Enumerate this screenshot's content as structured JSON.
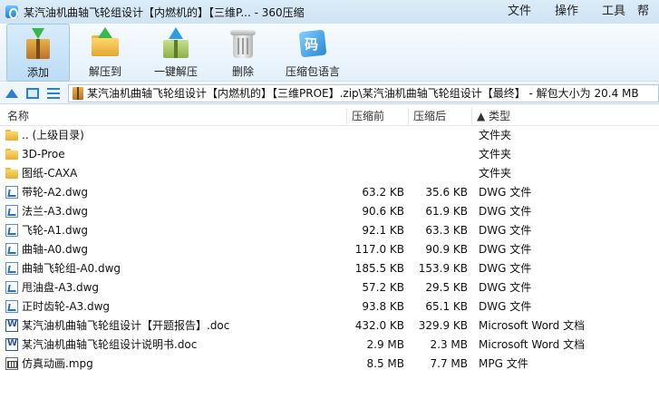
{
  "window": {
    "title": "某汽油机曲轴飞轮组设计【内燃机的】【三维P... - 360压缩",
    "menu": [
      "文件",
      "操作",
      "工具",
      "帮"
    ]
  },
  "toolbar": {
    "add_label": "添加",
    "extract_label": "解压到",
    "oneclick_label": "一键解压",
    "delete_label": "删除",
    "lang_label": "压缩包语言",
    "lang_glyph": "码"
  },
  "address": {
    "path": "某汽油机曲轴飞轮组设计【内燃机的】【三维PROE】.zip\\某汽油机曲轴飞轮组设计【最终】 - 解包大小为 20.4 MB"
  },
  "columns": {
    "name": "名称",
    "size": "压缩前",
    "packed": "压缩后",
    "type": "▲ 类型"
  },
  "files": [
    {
      "icon": "folder",
      "name": ".. (上级目录)",
      "size": "",
      "packed": "",
      "type": "文件夹"
    },
    {
      "icon": "folder",
      "name": "3D-Proe",
      "size": "",
      "packed": "",
      "type": "文件夹"
    },
    {
      "icon": "folder",
      "name": "图纸-CAXA",
      "size": "",
      "packed": "",
      "type": "文件夹"
    },
    {
      "icon": "dwg",
      "name": "带轮-A2.dwg",
      "size": "63.2 KB",
      "packed": "35.6 KB",
      "type": "DWG 文件"
    },
    {
      "icon": "dwg",
      "name": "法兰-A3.dwg",
      "size": "90.6 KB",
      "packed": "61.9 KB",
      "type": "DWG 文件"
    },
    {
      "icon": "dwg",
      "name": "飞轮-A1.dwg",
      "size": "92.1 KB",
      "packed": "63.3 KB",
      "type": "DWG 文件"
    },
    {
      "icon": "dwg",
      "name": "曲轴-A0.dwg",
      "size": "117.0 KB",
      "packed": "90.9 KB",
      "type": "DWG 文件"
    },
    {
      "icon": "dwg",
      "name": "曲轴飞轮组-A0.dwg",
      "size": "185.5 KB",
      "packed": "153.9 KB",
      "type": "DWG 文件"
    },
    {
      "icon": "dwg",
      "name": "甩油盘-A3.dwg",
      "size": "57.2 KB",
      "packed": "29.5 KB",
      "type": "DWG 文件"
    },
    {
      "icon": "dwg",
      "name": "正时齿轮-A3.dwg",
      "size": "93.8 KB",
      "packed": "65.1 KB",
      "type": "DWG 文件"
    },
    {
      "icon": "doc",
      "name": "某汽油机曲轴飞轮组设计【开题报告】.doc",
      "size": "432.0 KB",
      "packed": "329.9 KB",
      "type": "Microsoft Word 文档"
    },
    {
      "icon": "doc",
      "name": "某汽油机曲轴飞轮组设计说明书.doc",
      "size": "2.9 MB",
      "packed": "2.3 MB",
      "type": "Microsoft Word 文档"
    },
    {
      "icon": "mpg",
      "name": "仿真动画.mpg",
      "size": "8.5 MB",
      "packed": "7.7 MB",
      "type": "MPG 文件"
    }
  ]
}
